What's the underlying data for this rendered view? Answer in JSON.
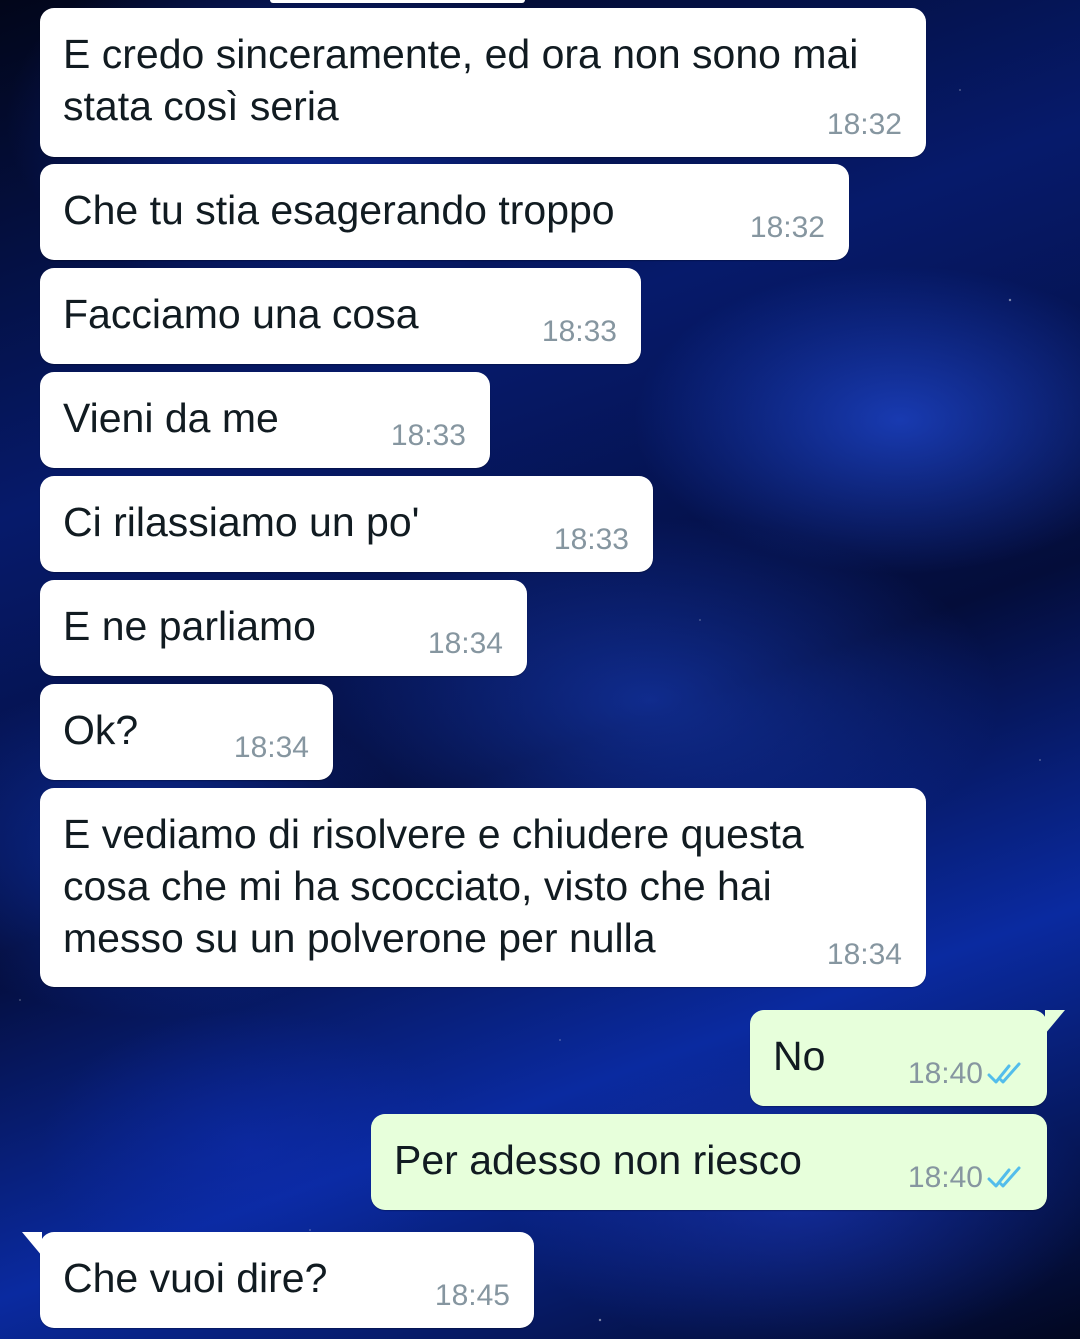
{
  "colors": {
    "incoming_bubble": "#ffffff",
    "outgoing_bubble": "#e7ffdb",
    "message_text": "#111b21",
    "timestamp": "#8696a0",
    "read_ticks": "#53bdeb"
  },
  "messages": [
    {
      "direction": "incoming",
      "text": "E credo sinceramente, ed ora non sono mai stata così seria",
      "time": "18:32"
    },
    {
      "direction": "incoming",
      "text": "Che tu stia esagerando troppo",
      "time": "18:32"
    },
    {
      "direction": "incoming",
      "text": "Facciamo una cosa",
      "time": "18:33"
    },
    {
      "direction": "incoming",
      "text": "Vieni da me",
      "time": "18:33"
    },
    {
      "direction": "incoming",
      "text": "Ci rilassiamo un po'",
      "time": "18:33"
    },
    {
      "direction": "incoming",
      "text": "E ne parliamo",
      "time": "18:34"
    },
    {
      "direction": "incoming",
      "text": "Ok?",
      "time": "18:34"
    },
    {
      "direction": "incoming",
      "text": "E vediamo di risolvere e chiudere questa cosa che mi ha scocciato, visto che hai messo su un polverone per nulla",
      "time": "18:34"
    },
    {
      "direction": "outgoing",
      "text": "No",
      "time": "18:40",
      "status_icon": "double-check-read-icon"
    },
    {
      "direction": "outgoing",
      "text": "Per adesso non riesco",
      "time": "18:40",
      "status_icon": "double-check-read-icon"
    },
    {
      "direction": "incoming",
      "text": "Che vuoi dire?",
      "time": "18:45"
    }
  ]
}
